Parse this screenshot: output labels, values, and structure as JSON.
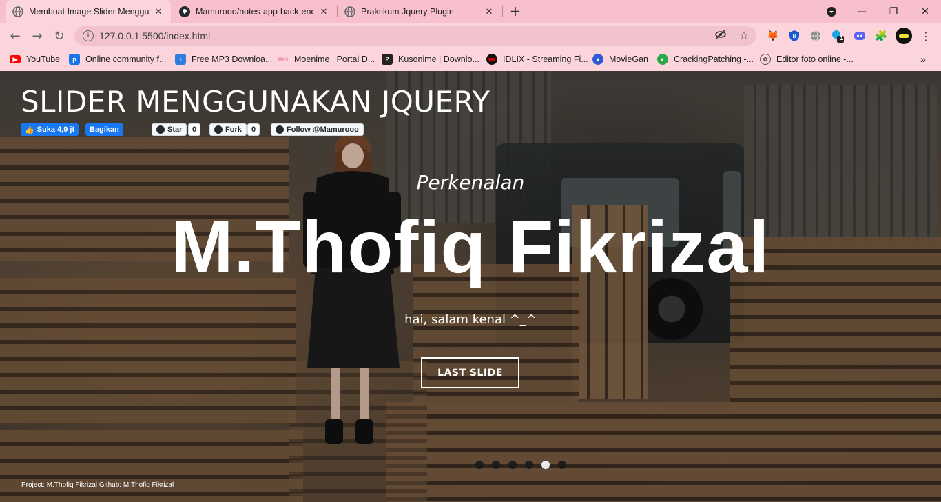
{
  "browser": {
    "tabs": [
      {
        "title": "Membuat Image Slider Menggun",
        "active": true,
        "icon": "globe-icon"
      },
      {
        "title": "Mamurooo/notes-app-back-end",
        "active": false,
        "icon": "github-icon"
      },
      {
        "title": "Praktikum Jquery Plugin",
        "active": false,
        "icon": "globe-icon"
      }
    ],
    "url": "127.0.0.1:5500/index.html",
    "extension_badge": "1",
    "bookmarks": [
      {
        "label": "YouTube",
        "icon": "youtube-icon",
        "color": "#ff0000"
      },
      {
        "label": "Online community f...",
        "icon": "community-icon",
        "color": "#1a73e8"
      },
      {
        "label": "Free MP3 Downloa...",
        "icon": "music-icon",
        "color": "#2f7de1"
      },
      {
        "label": "Moenime | Portal D...",
        "icon": "moenime-icon",
        "color": "#e88aa8"
      },
      {
        "label": "Kusonime | Downlo...",
        "icon": "kusonime-icon",
        "color": "#222222"
      },
      {
        "label": "IDLIX - Streaming Fi...",
        "icon": "idlix-icon",
        "color": "#d00000"
      },
      {
        "label": "MovieGan",
        "icon": "moviegan-icon",
        "color": "#2d5bd3"
      },
      {
        "label": "CrackingPatching -...",
        "icon": "crackingpatching-icon",
        "color": "#2aa84a"
      },
      {
        "label": "Editor foto online -...",
        "icon": "editor-icon",
        "color": "#555555"
      }
    ]
  },
  "page": {
    "title": "SLIDER MENGGUNAKAN JQUERY",
    "social": {
      "fb_like": "Suka 4,9 jt",
      "fb_share": "Bagikan",
      "gh_star": "Star",
      "gh_star_count": "0",
      "gh_fork": "Fork",
      "gh_fork_count": "0",
      "gh_follow": "Follow @Mamurooo"
    },
    "slide": {
      "subtitle": "Perkenalan",
      "heading": "M.Thofiq Fikrizal",
      "text": "hai, salam kenal ^_^",
      "button": "LAST SLIDE"
    },
    "dots": {
      "count": 6,
      "active_index": 4
    },
    "footer": {
      "prefix": "Project: ",
      "project_link": "M.Thofiq Fikrizal",
      "github_prefix": " Github: ",
      "github_link": "M.Thofiq Fikrizal"
    }
  }
}
